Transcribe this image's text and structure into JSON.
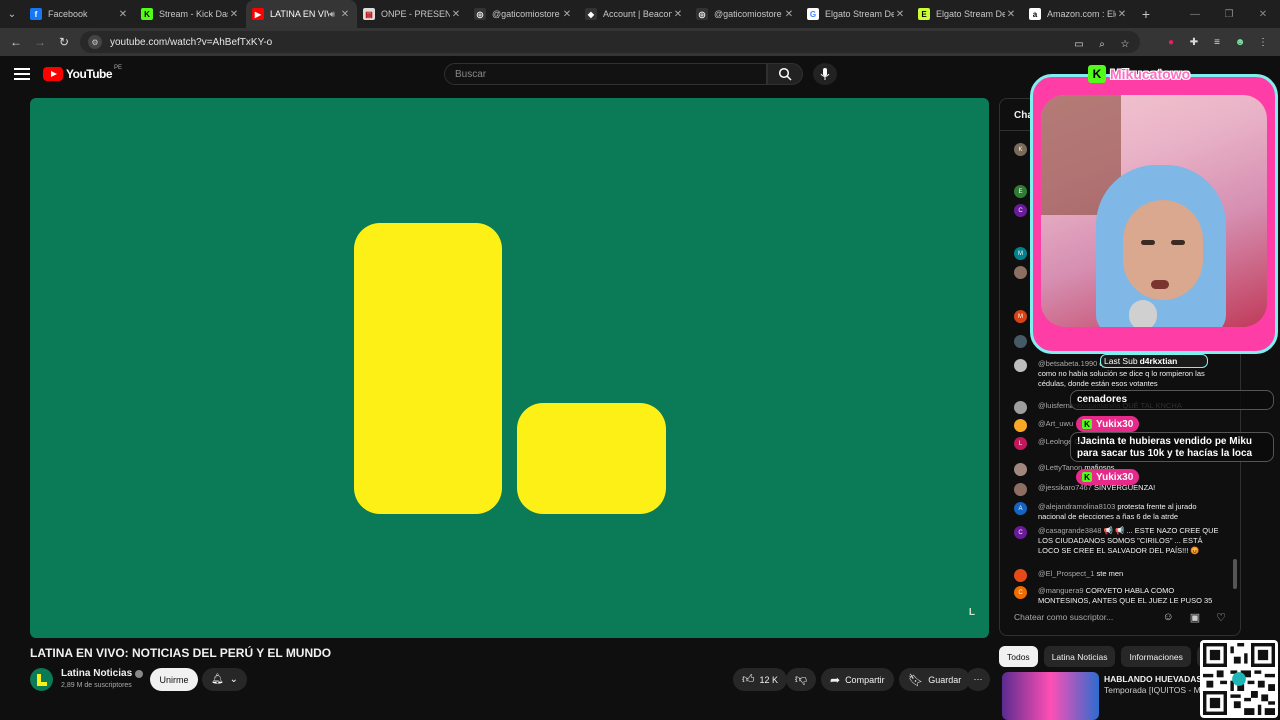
{
  "browser": {
    "tabs": [
      {
        "title": "Facebook",
        "fav": "f",
        "favbg": "#1877f2",
        "favcolor": "#ffffff"
      },
      {
        "title": "Stream - Kick Dash",
        "fav": "K",
        "favbg": "#53fc18",
        "favcolor": "#000000"
      },
      {
        "title": "LATINA EN VIV",
        "fav": "▶",
        "favbg": "#ff0000",
        "favcolor": "#ffffff",
        "active": true
      },
      {
        "title": "ONPE - PRESENTA",
        "fav": "▤",
        "favbg": "#dddddd",
        "favcolor": "#c00000"
      },
      {
        "title": "@gaticomiostore",
        "fav": "◎",
        "favbg": "#333333",
        "favcolor": "#ffffff"
      },
      {
        "title": "Account | Beacon",
        "fav": "◆",
        "favbg": "#333333",
        "favcolor": "#ffffff"
      },
      {
        "title": "@gaticomiostore",
        "fav": "◎",
        "favbg": "#333333",
        "favcolor": "#ffffff"
      },
      {
        "title": "Elgato Stream De",
        "fav": "G",
        "favbg": "#ffffff",
        "favcolor": "#4285f4"
      },
      {
        "title": "Elgato Stream De",
        "fav": "E",
        "favbg": "#ccff33",
        "favcolor": "#000000"
      },
      {
        "title": "Amazon.com : Elg",
        "fav": "a",
        "favbg": "#ffffff",
        "favcolor": "#000000"
      }
    ],
    "url": "youtube.com/watch?v=AhBefTxKY-o"
  },
  "youtube": {
    "logo_text": "YouTube",
    "country": "PE",
    "search_placeholder": "Buscar"
  },
  "video": {
    "title": "LATINA EN VIVO: NOTICIAS DEL PERÚ Y EL MUNDO",
    "channel": "Latina Noticias",
    "subscribers": "2,89 M de suscriptores",
    "join_label": "Unirme",
    "likes": "12 K",
    "share_label": "Compartir",
    "save_label": "Guardar",
    "player_bg": "#0b7a57",
    "logo_color": "#fcf017"
  },
  "chat": {
    "header": "Cha",
    "input_placeholder": "Chatear como suscriptor...",
    "messages": [
      {
        "initial": "K",
        "color": "#7a6a5a",
        "author": "",
        "text": ""
      },
      {
        "initial": "E",
        "color": "#2e7d32",
        "author": "",
        "text": ""
      },
      {
        "initial": "C",
        "color": "#6a1b9a",
        "author": "",
        "text": ""
      },
      {
        "initial": "M",
        "color": "#00838f",
        "author": "",
        "text": ""
      },
      {
        "initial": "",
        "color": "#8d6e63",
        "author": "",
        "text": ""
      },
      {
        "initial": "M",
        "color": "#d84315",
        "author": "",
        "text": ""
      },
      {
        "initial": "",
        "color": "#455a64",
        "author": "",
        "text": "HO"
      },
      {
        "initial": "",
        "color": "#bdbdbd",
        "author": "@betsabeta.1990",
        "text": "q perjudico la mesa d sufragio y como no había solución se dice q lo rompieron las cédulas, donde están esos votantes"
      },
      {
        "initial": "",
        "color": "#9e9e9e",
        "author": "@luisfernandoquintanilla",
        "text": "QUÉ TAL KNCHA"
      },
      {
        "initial": "",
        "color": "#f9a825",
        "author": "@Art_uwu",
        "text": ""
      },
      {
        "initial": "L",
        "color": "#c2185b",
        "author": "@Leolnge",
        "text": "CINISMO"
      },
      {
        "initial": "",
        "color": "#a1887f",
        "author": "@LettyTanon",
        "text": "mafiosos"
      },
      {
        "initial": "",
        "color": "#8d6e63",
        "author": "@jessikaro7467",
        "text": "SINVERGUENZA!"
      },
      {
        "initial": "A",
        "color": "#1565c0",
        "author": "@alejandramolina8103",
        "text": "protesta frente al jurado nacional de elecciones a ñas 6 de la atrde"
      },
      {
        "initial": "C",
        "color": "#6a1b9a",
        "author": "@casagrande3848",
        "text": "📢 📢 ... ESTE NAZO CREE QUE LOS CIUDADANOS SOMOS \"CIRILOS\" ... ESTÁ LOCO SE CREE EL SALVADOR DEL PAÍS!!! 😡"
      },
      {
        "initial": "",
        "color": "#e64a19",
        "author": "@El_Prospect_1",
        "text": "ste men"
      },
      {
        "initial": "C",
        "color": "#ef6c00",
        "author": "@manguera9",
        "text": "CORVETO HABLA COMO MONTESINOS, ANTES QUE EL JUEZ LE PUSO 35"
      }
    ]
  },
  "chips": [
    "Todos",
    "Latina Noticias",
    "Informaciones",
    "N"
  ],
  "recommendation": {
    "line1": "HABLANDO HUEVADAS -",
    "line2": "Temporada [IQUITOS - MI"
  },
  "overlay": {
    "streamer": "Mikucatowo",
    "last_sub_label": "Last Sub",
    "last_sub_name": "d4rkxtian",
    "partial_text": "cenadores",
    "alert_user": "Yukix30",
    "alert_text": "!Jacinta te hubieras vendido pe Miku para sacar tus 10k y te hacías la loca",
    "alert_user2": "Yukix30",
    "frame_color": "#ff3da6",
    "border_color": "#7ff0f0"
  }
}
